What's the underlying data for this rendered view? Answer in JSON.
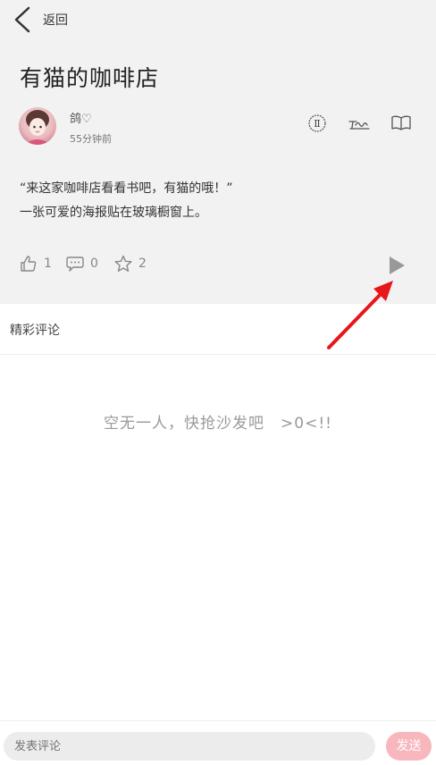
{
  "header": {
    "back_label": "返回"
  },
  "post": {
    "title": "有猫的咖啡店",
    "author": "鸽♡",
    "time": "55分钟前",
    "lines": [
      "“来这家咖啡店看看书吧，有猫的哦！”",
      "一张可爱的海报贴在玻璃橱窗上。"
    ],
    "likes": "1",
    "comments": "0",
    "favorites": "2"
  },
  "comments_section": {
    "title": "精彩评论",
    "empty_text": "空无一人，快抢沙发吧　>0<!!"
  },
  "footer": {
    "input_placeholder": "发表评论",
    "send_label": "发送"
  },
  "colors": {
    "accent_pink": "#f7b7bd",
    "arrow_red": "#e8161b"
  }
}
